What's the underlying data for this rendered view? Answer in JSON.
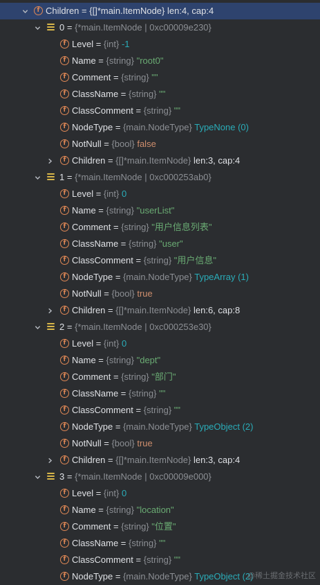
{
  "root": {
    "name": "Children",
    "eq": "=",
    "type": "{[]*main.ItemNode}",
    "meta": "len:4, cap:4"
  },
  "nodes": [
    {
      "index": "0",
      "type": "{*main.ItemNode",
      "addr": "0xc00009e230}",
      "fields": [
        {
          "name": "Level",
          "type": "{int}",
          "value": "-1",
          "vclass": "n"
        },
        {
          "name": "Name",
          "type": "{string}",
          "value": "\"root0\"",
          "vclass": "s"
        },
        {
          "name": "Comment",
          "type": "{string}",
          "value": "\"\"",
          "vclass": "s"
        },
        {
          "name": "ClassName",
          "type": "{string}",
          "value": "\"\"",
          "vclass": "s"
        },
        {
          "name": "ClassComment",
          "type": "{string}",
          "value": "\"\"",
          "vclass": "s"
        },
        {
          "name": "NodeType",
          "type": "{main.NodeType}",
          "value": "TypeNone (0)",
          "vclass": "e"
        },
        {
          "name": "NotNull",
          "type": "{bool}",
          "value": "false",
          "vclass": "kw"
        }
      ],
      "children": {
        "name": "Children",
        "type": "{[]*main.ItemNode}",
        "meta": "len:3, cap:4"
      }
    },
    {
      "index": "1",
      "type": "{*main.ItemNode",
      "addr": "0xc000253ab0}",
      "fields": [
        {
          "name": "Level",
          "type": "{int}",
          "value": "0",
          "vclass": "n"
        },
        {
          "name": "Name",
          "type": "{string}",
          "value": "\"userList\"",
          "vclass": "s"
        },
        {
          "name": "Comment",
          "type": "{string}",
          "value": "\"用户信息列表\"",
          "vclass": "s"
        },
        {
          "name": "ClassName",
          "type": "{string}",
          "value": "\"user\"",
          "vclass": "s"
        },
        {
          "name": "ClassComment",
          "type": "{string}",
          "value": "\"用户信息\"",
          "vclass": "s"
        },
        {
          "name": "NodeType",
          "type": "{main.NodeType}",
          "value": "TypeArray (1)",
          "vclass": "e"
        },
        {
          "name": "NotNull",
          "type": "{bool}",
          "value": "true",
          "vclass": "kw"
        }
      ],
      "children": {
        "name": "Children",
        "type": "{[]*main.ItemNode}",
        "meta": "len:6, cap:8"
      }
    },
    {
      "index": "2",
      "type": "{*main.ItemNode",
      "addr": "0xc000253e30}",
      "fields": [
        {
          "name": "Level",
          "type": "{int}",
          "value": "0",
          "vclass": "n"
        },
        {
          "name": "Name",
          "type": "{string}",
          "value": "\"dept\"",
          "vclass": "s"
        },
        {
          "name": "Comment",
          "type": "{string}",
          "value": "\"部门\"",
          "vclass": "s"
        },
        {
          "name": "ClassName",
          "type": "{string}",
          "value": "\"\"",
          "vclass": "s"
        },
        {
          "name": "ClassComment",
          "type": "{string}",
          "value": "\"\"",
          "vclass": "s"
        },
        {
          "name": "NodeType",
          "type": "{main.NodeType}",
          "value": "TypeObject (2)",
          "vclass": "e"
        },
        {
          "name": "NotNull",
          "type": "{bool}",
          "value": "true",
          "vclass": "kw"
        }
      ],
      "children": {
        "name": "Children",
        "type": "{[]*main.ItemNode}",
        "meta": "len:3, cap:4"
      }
    },
    {
      "index": "3",
      "type": "{*main.ItemNode",
      "addr": "0xc00009e000}",
      "fields": [
        {
          "name": "Level",
          "type": "{int}",
          "value": "0",
          "vclass": "n"
        },
        {
          "name": "Name",
          "type": "{string}",
          "value": "\"location\"",
          "vclass": "s"
        },
        {
          "name": "Comment",
          "type": "{string}",
          "value": "\"位置\"",
          "vclass": "s"
        },
        {
          "name": "ClassName",
          "type": "{string}",
          "value": "\"\"",
          "vclass": "s"
        },
        {
          "name": "ClassComment",
          "type": "{string}",
          "value": "\"\"",
          "vclass": "s"
        },
        {
          "name": "NodeType",
          "type": "{main.NodeType}",
          "value": "TypeObject (2)",
          "vclass": "e"
        }
      ],
      "children": null
    }
  ],
  "watermark": "@稀土掘金技术社区",
  "colors": {
    "background": "#2b2d30",
    "selected_row": "#2e436e",
    "field_icon": "#e08855",
    "array_icon": "#d8b64a",
    "string_value": "#6aab73",
    "number_value": "#2aacb8",
    "keyword_value": "#cf8e6d",
    "type_hint": "#8c8f94"
  },
  "icons": {
    "expanded": "chevron-down-icon",
    "collapsed": "chevron-right-icon",
    "field": "field-icon",
    "array": "array-element-icon"
  }
}
